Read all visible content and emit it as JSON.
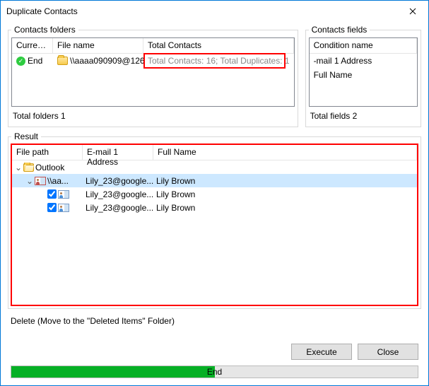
{
  "window": {
    "title": "Duplicate Contacts"
  },
  "folders": {
    "legend": "Contacts folders",
    "headers": {
      "current": "Curren...",
      "filename": "File name",
      "total": "Total Contacts"
    },
    "rows": [
      {
        "current": "End",
        "filename": "\\\\aaaa090909@126...",
        "total_note": "Total Contacts: 16; Total Duplicates: 1"
      }
    ],
    "totals_label": "Total folders  1"
  },
  "fields": {
    "legend": "Contacts fields",
    "header": "Condition name",
    "items": [
      "-mail 1 Address",
      "Full Name"
    ],
    "totals_label": "Total fields  2"
  },
  "result": {
    "legend": "Result",
    "headers": {
      "path": "File path",
      "email": "E-mail 1 Address",
      "name": "Full Name"
    },
    "tree": {
      "root": "Outlook",
      "sub": "\\\\aa...",
      "sub_email": "Lily_23@google...",
      "sub_name": "Lily Brown",
      "items": [
        {
          "email": "Lily_23@google...",
          "name": "Lily Brown",
          "checked": true
        },
        {
          "email": "Lily_23@google...",
          "name": "Lily Brown",
          "checked": true
        }
      ]
    }
  },
  "footer": {
    "delete_label": "Delete (Move to the \"Deleted Items\" Folder)",
    "execute": "Execute",
    "close": "Close",
    "progress": {
      "percent": 50,
      "label": "End"
    }
  }
}
